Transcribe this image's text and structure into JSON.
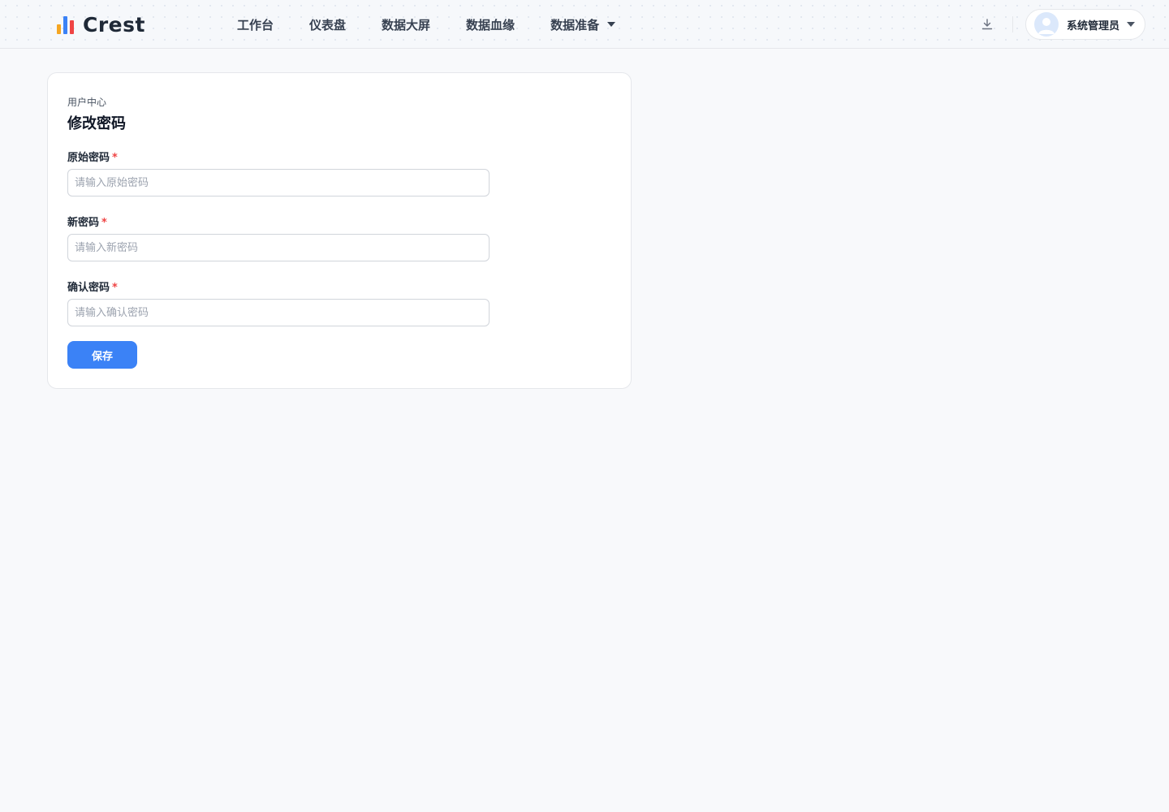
{
  "header": {
    "logo_text": "Crest",
    "nav": [
      {
        "label": "工作台"
      },
      {
        "label": "仪表盘"
      },
      {
        "label": "数据大屏"
      },
      {
        "label": "数据血缘"
      },
      {
        "label": "数据准备",
        "dropdown": true
      }
    ],
    "download_icon": "download-icon",
    "user": {
      "name": "系统管理员",
      "avatar_icon": "user-avatar-icon"
    }
  },
  "card": {
    "breadcrumb": "用户中心",
    "title": "修改密码",
    "fields": [
      {
        "label": "原始密码",
        "required_mark": "*",
        "placeholder": "请输入原始密码",
        "value": ""
      },
      {
        "label": "新密码",
        "required_mark": "*",
        "placeholder": "请输入新密码",
        "value": ""
      },
      {
        "label": "确认密码",
        "required_mark": "*",
        "placeholder": "请输入确认密码",
        "value": ""
      }
    ],
    "save_label": "保存"
  },
  "colors": {
    "primary": "#3b82f6",
    "required": "#ef4444",
    "background": "#f8f9fb",
    "logo_bars": [
      "#f5a623",
      "#3b82f6",
      "#ef4444"
    ]
  }
}
